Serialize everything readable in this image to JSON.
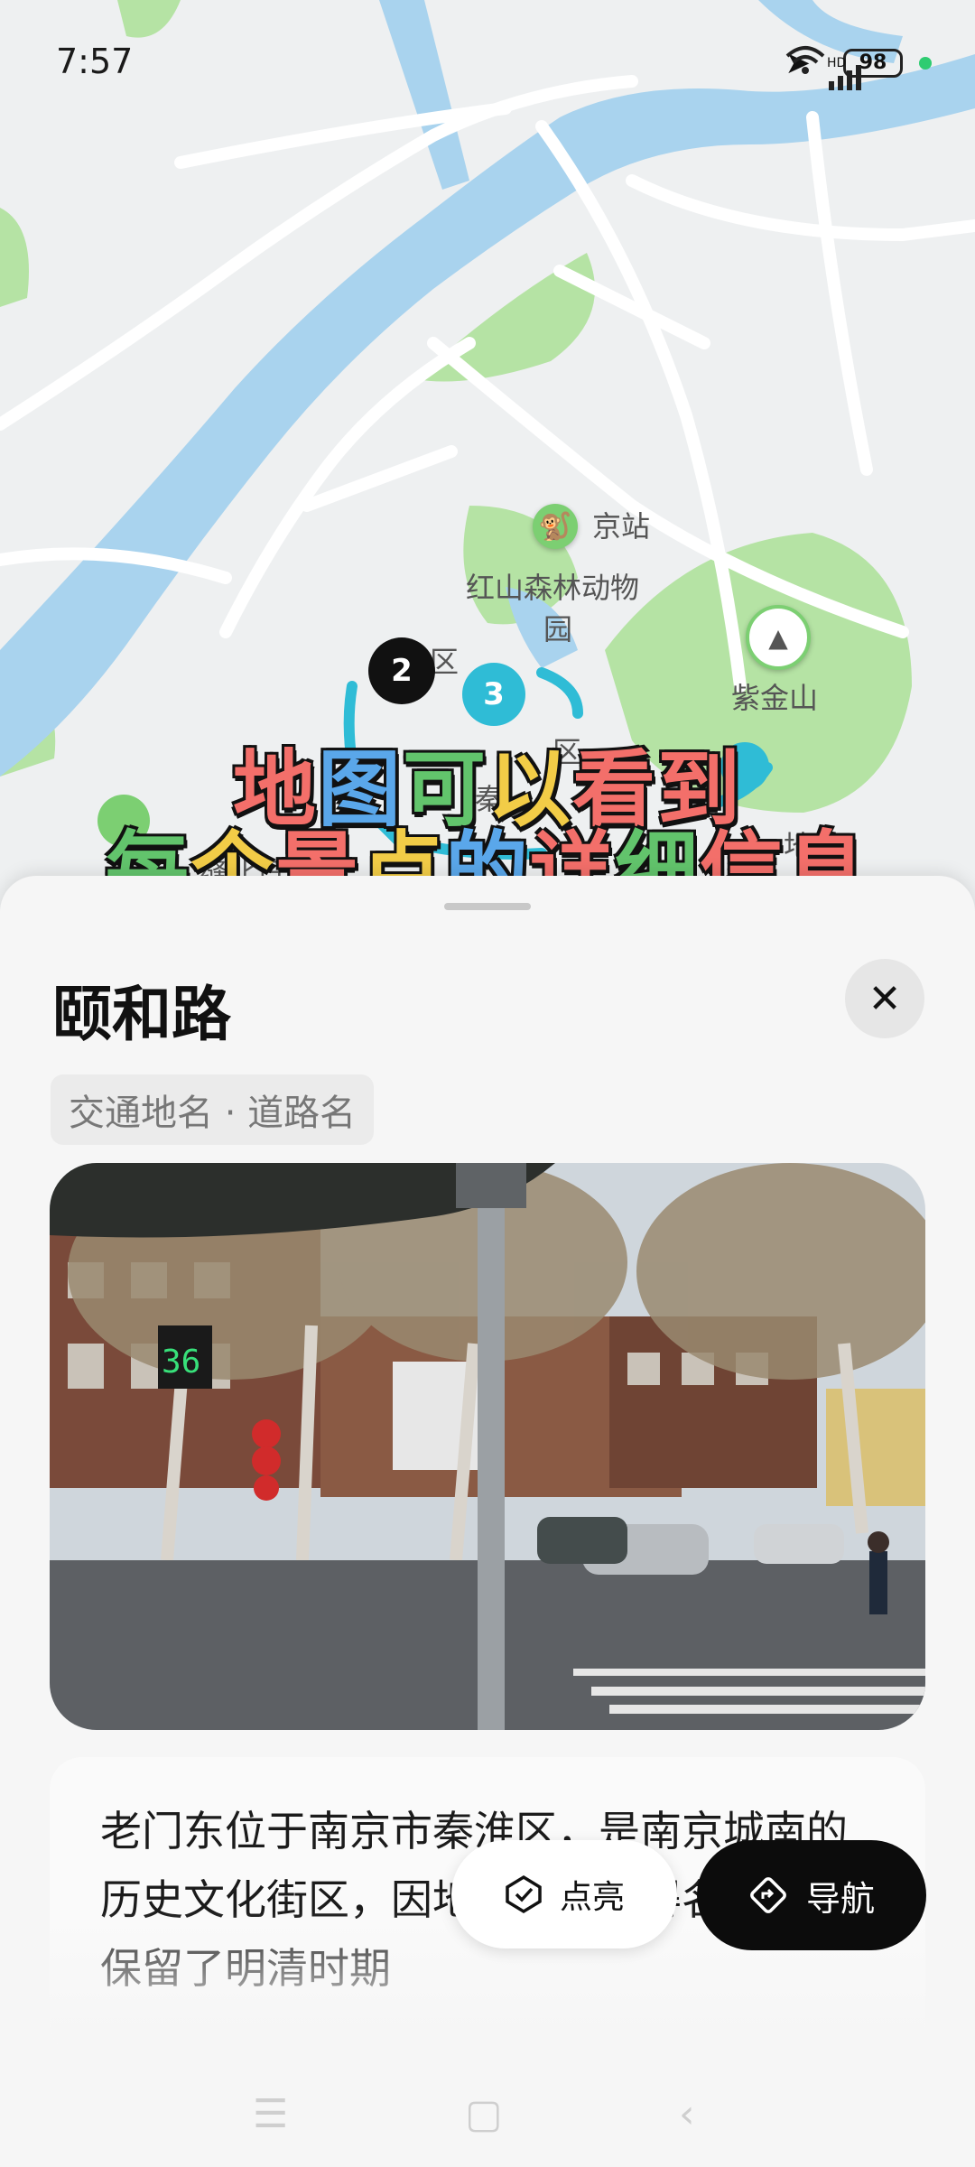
{
  "status_bar": {
    "time": "7:57",
    "hd_label": "HD",
    "battery": "98"
  },
  "map": {
    "labels": {
      "station": "京站",
      "zoo_line1": "红山森林动物",
      "zoo_line2": "园",
      "mountain": "紫金山",
      "district_fragment": "区",
      "district_fragment2": "区",
      "qin_fragment": "秦",
      "left_fragment": "东",
      "bottom_fragment": "缝北日",
      "right_fragment": "地"
    },
    "markers": [
      {
        "label": "2"
      },
      {
        "label": "3"
      }
    ],
    "icons": {
      "zoo": "monkey-icon",
      "mountain": "mountain-icon"
    }
  },
  "overlay": {
    "line1": [
      "地",
      "图",
      "可",
      "以",
      "看",
      "到"
    ],
    "line2": [
      "每",
      "个",
      "景",
      "点",
      "的",
      "详",
      "细",
      "信",
      "息"
    ]
  },
  "sheet": {
    "title": "颐和路",
    "tag": "交通地名 · 道路名",
    "description": "老门东位于南京市秦淮区，是南京城南的历史文化街区，因地处门以东得名。街区保留了明清时期",
    "light_button": "点亮",
    "nav_button": "导航",
    "photo_sign": "36"
  },
  "colors": {
    "water": "#a9d3ee",
    "park": "#b5e3a4",
    "accent": "#2fbcd6",
    "nav_bg": "#0c0c0c"
  }
}
